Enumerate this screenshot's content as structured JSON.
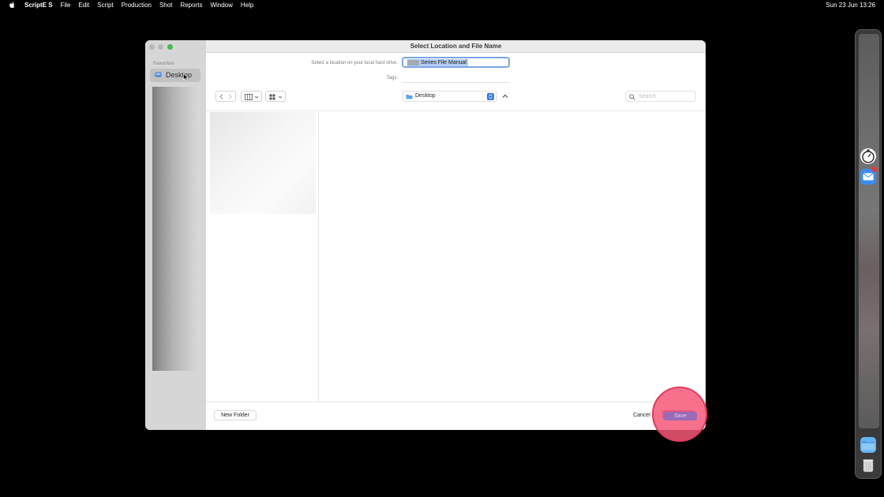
{
  "menubar": {
    "app_name": "ScriptE S",
    "items": [
      "File",
      "Edit",
      "Script",
      "Production",
      "Shot",
      "Reports",
      "Window",
      "Help"
    ],
    "clock": "Sun 23 Jun  13:26"
  },
  "dialog": {
    "title": "Select Location and File Name",
    "sidebar": {
      "section_title": "Favorites",
      "items": [
        {
          "label": "Desktop"
        }
      ]
    },
    "location_prompt": "Select a location on your local hard drive.",
    "filename_value": "Series File Manual",
    "tags_label": "Tags:",
    "location_select": "Desktop",
    "search_placeholder": "Search",
    "new_folder_label": "New Folder",
    "cancel_label": "Cancel",
    "save_label": "Save"
  },
  "colors": {
    "accent": "#3478f6",
    "save_button": "#8e5fae",
    "click_highlight": "#f65878"
  },
  "icons": {
    "apple": "apple-logo-icon",
    "sidebar_desktop": "desktop-icon",
    "location_folder": "folder-icon",
    "search": "search-icon"
  }
}
